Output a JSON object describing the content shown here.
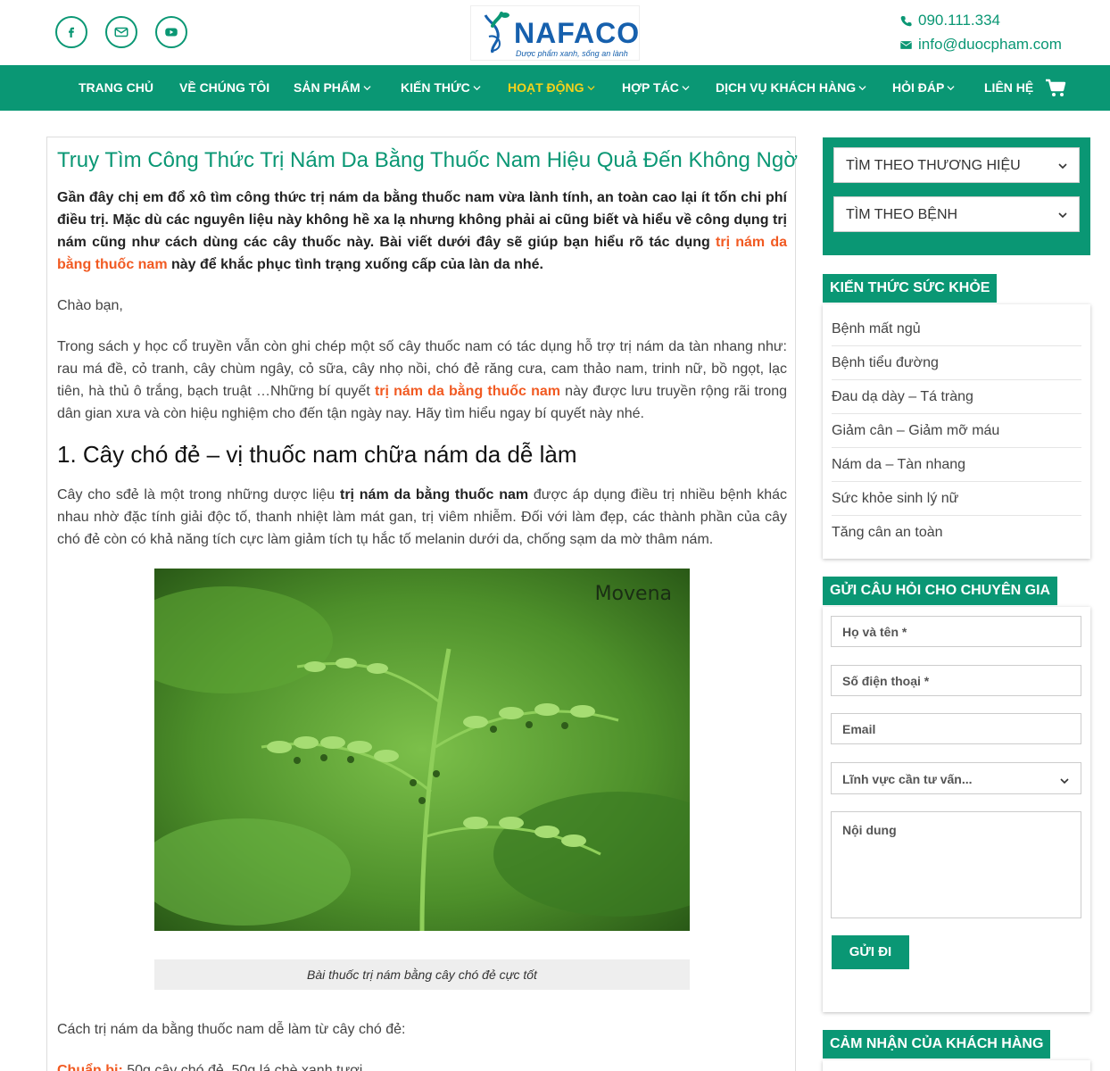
{
  "header": {
    "logo_text": "NAFACO",
    "logo_tagline": "Dược phẩm xanh, sống an lành",
    "phone": "090.111.334",
    "email": "info@duocpham.com",
    "social": [
      "facebook-icon",
      "mail-icon",
      "youtube-icon"
    ]
  },
  "nav": {
    "items": [
      {
        "label": "TRANG CHỦ",
        "dropdown": false
      },
      {
        "label": "VỀ CHÚNG TÔI",
        "dropdown": false
      },
      {
        "label": "SẢN PHẨM",
        "dropdown": true
      },
      {
        "label": "KIẾN THỨC",
        "dropdown": true
      },
      {
        "label": "HOẠT ĐỘNG",
        "dropdown": true,
        "active": true
      },
      {
        "label": "HỢP TÁC",
        "dropdown": true
      },
      {
        "label": "DỊCH VỤ KHÁCH HÀNG",
        "dropdown": true
      },
      {
        "label": "HỎI ĐÁP",
        "dropdown": true
      },
      {
        "label": "LIÊN HỆ",
        "dropdown": false
      }
    ]
  },
  "article": {
    "title": "Truy Tìm Công Thức Trị Nám Da Bằng Thuốc Nam Hiệu Quả Đến Không Ngờ",
    "intro_a": "Gần đây chị em đổ xô tìm công thức trị nám da bằng thuốc nam vừa lành tính, an toàn cao lại ít tốn chi phí điều trị. Mặc dù các nguyên liệu này không hề xa lạ nhưng không phải ai cũng biết và hiểu về công dụng trị nám cũng như cách dùng các cây thuốc này. Bài viết dưới đây sẽ giúp bạn hiểu rõ tác dụng ",
    "intro_link": "trị nám da bằng thuốc nam",
    "intro_b": " này để khắc phục tình trạng xuống cấp của làn da nhé.",
    "greeting": "Chào bạn,",
    "p2_a": "Trong sách y học cổ truyền vẫn còn ghi chép một số cây thuốc nam có tác dụng hỗ trợ trị nám da tàn nhang như: rau má đề, cỏ tranh, cây chùm ngây, cỏ sữa, cây nhọ nồi, chó đẻ răng cưa, cam thảo nam, trinh nữ, bồ ngọt, lạc tiên, hà thủ ô trắng, bạch truật …Những bí quyết ",
    "p2_link": "trị nám da bằng thuốc nam",
    "p2_b": " này được lưu truyền rộng rãi trong dân gian xưa và còn hiệu nghiệm cho đến tận ngày nay. Hãy tìm hiểu ngay bí quyết này nhé.",
    "h2": "1. Cây chó đẻ – vị thuốc nam chữa nám da dễ làm",
    "p3_a": "Cây cho sđẻ là một trong những dược liệu ",
    "p3_bold": "trị nám da bằng thuốc nam",
    "p3_b": " được áp dụng điều trị nhiều bệnh khác nhau nhờ đặc tính giải độc tố, thanh nhiệt làm mát gan, trị viêm nhiễm. Đối với làm đẹp, các thành phần của cây chó đẻ còn có khả năng tích cực làm giảm tích tụ hắc tố melanin dưới da, chống sạm da mờ thâm nám.",
    "image_watermark": "Movena",
    "caption": "Bài thuốc trị nám bằng cây chó đẻ cực tốt",
    "p4": "Cách trị nám da bằng thuốc nam dễ làm từ cây chó đẻ:",
    "prep_label": "Chuẩn bị:",
    "prep_text": " 50g cây chó đẻ, 50g lá chè xanh tươi"
  },
  "sidebar": {
    "filters": [
      "TÌM THEO THƯƠNG HIỆU",
      "TÌM THEO BỆNH"
    ],
    "health_title": "KIẾN THỨC SỨC KHỎE",
    "health_items": [
      "Bệnh mất ngủ",
      "Bệnh tiểu đường",
      "Đau dạ dày – Tá tràng",
      "Giảm cân – Giảm mỡ máu",
      "Nám da – Tàn nhang",
      "Sức khỏe sinh lý nữ",
      "Tăng cân an toàn"
    ],
    "form_title": "GỬI CÂU HỎI CHO CHUYÊN GIA",
    "form": {
      "name_ph": "Họ và tên *",
      "phone_ph": "Số điện thoại *",
      "email_ph": "Email",
      "field_select": "Lĩnh vực cần tư vấn...",
      "content_ph": "Nội dung",
      "submit": "GỬI ĐI"
    },
    "reviews_title": "CẢM NHẬN CỦA KHÁCH HÀNG"
  },
  "colors": {
    "brand": "#0a9774",
    "active_nav": "#f5d21b",
    "link": "#f15a22",
    "logo": "#1660ad"
  }
}
